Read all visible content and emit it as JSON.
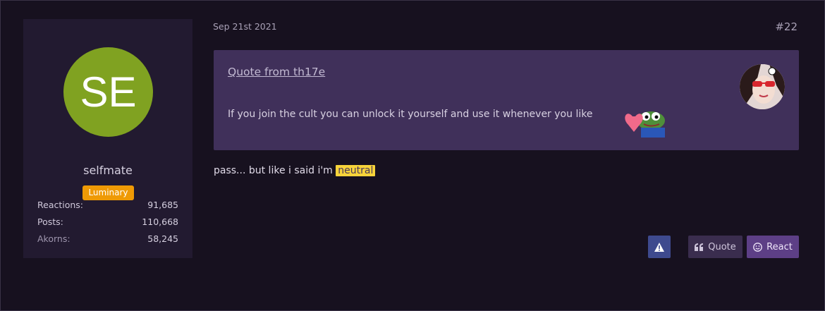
{
  "user": {
    "avatar_initials": "SE",
    "avatar_color": "#80a221",
    "username": "selfmate",
    "rank": "Luminary",
    "rank_color": "#ef9a05",
    "stats": [
      {
        "label": "Reactions:",
        "value": "91,685"
      },
      {
        "label": "Posts:",
        "value": "110,668"
      },
      {
        "label": "Akorns:",
        "value": "58,245"
      }
    ]
  },
  "post": {
    "date": "Sep 21st 2021",
    "number": "#22",
    "quote": {
      "author_link": "Quote from th17e",
      "text": "If you join the cult you can unlock it yourself and use it whenever you like"
    },
    "reply_prefix": "pass... but like i said i'm ",
    "reply_highlight": "neutral"
  },
  "actions": {
    "report_icon": "warning-icon",
    "quote_label": "Quote",
    "quote_icon": "quote-icon",
    "react_label": "React",
    "react_icon": "smile-icon"
  }
}
